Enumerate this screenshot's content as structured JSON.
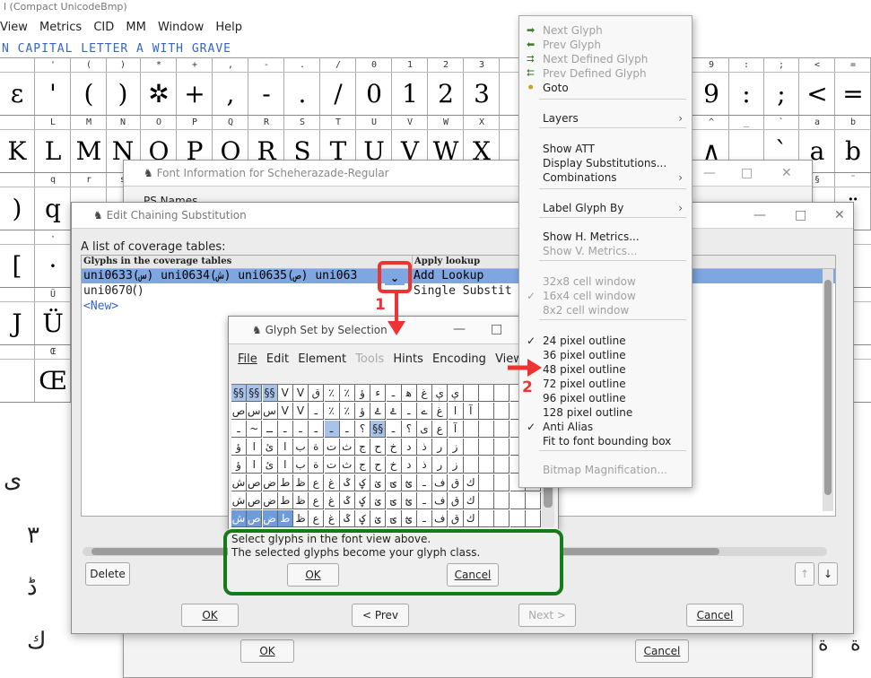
{
  "fontview": {
    "title": "l (Compact UnicodeBmp)",
    "menu": [
      "View",
      "Metrics",
      "CID",
      "MM",
      "Window",
      "Help"
    ],
    "glyph_name": "N CAPITAL LETTER A WITH GRAVE",
    "rows": [
      {
        "hdr": [
          "",
          "'",
          "(",
          ")",
          "*",
          "+",
          ",",
          "-",
          ".",
          "/",
          "0",
          "1",
          "2",
          "3"
        ],
        "big": [
          "ɛ",
          "'",
          "(",
          ")",
          "✲",
          "+",
          ",",
          "-",
          ".",
          "/",
          "0",
          "1",
          "2",
          "3"
        ]
      },
      {
        "hdr": [
          "",
          "L",
          "M",
          "N",
          "O",
          "P",
          "Q",
          "R",
          "S",
          "T",
          "U",
          "V",
          "W",
          "X"
        ],
        "big": [
          "K",
          "L",
          "M",
          "N",
          "O",
          "P",
          "Q",
          "R",
          "S",
          "T",
          "U",
          "V",
          "W",
          "X"
        ]
      },
      {
        "hdr": [
          "",
          "q",
          "r",
          "s"
        ],
        "big": [
          ")",
          "q",
          "",
          ""
        ]
      },
      {
        "hdr": [
          "",
          "·"
        ],
        "big": [
          "[",
          "·"
        ]
      },
      {
        "hdr": [
          "",
          "Ü"
        ],
        "big": [
          "J",
          "Ü"
        ]
      },
      {
        "hdr": [
          "",
          "Œ"
        ],
        "big": [
          "",
          "Œ"
        ]
      }
    ],
    "right_rows": [
      {
        "hdr": [
          "9",
          ":",
          ";",
          "<",
          "="
        ],
        "big": [
          "9",
          ":",
          ";",
          "<",
          "="
        ]
      },
      {
        "hdr": [
          "^",
          "_",
          "`",
          "a",
          "b"
        ],
        "big": [
          "∧",
          "",
          "`",
          "a",
          "b"
        ]
      },
      {
        "hdr": [
          "",
          "",
          "",
          "§",
          "¨"
        ],
        "big": [
          "",
          "",
          "",
          "ς",
          "¨"
        ]
      }
    ],
    "left_col_bottom": [
      "ى",
      "٣",
      "ڈ",
      "ك"
    ],
    "right_col_bottom": [
      "ة",
      "ة"
    ]
  },
  "fontinfo": {
    "title": "Font Information for Scheherazade-Regular",
    "ps_label": "PS Names",
    "ok": "OK",
    "cancel": "Cancel"
  },
  "chain": {
    "title": "Edit Chaining Substitution",
    "coverage_label": "A list of coverage tables:",
    "col1": "Glyphs in the coverage tables",
    "col2": "Apply lookup",
    "rows": [
      {
        "glyphs": "uni0633(س) uni0634(ش) uni0635(ص) uni063",
        "lookup": "Add Lookup"
      },
      {
        "glyphs": "uni0670(ٰ)",
        "lookup": "Single Substit"
      }
    ],
    "new_label": "<New>",
    "delete": "Delete",
    "ok": "OK",
    "prev": "< Prev",
    "next": "Next >",
    "cancel": "Cancel",
    "up": "↑",
    "down": "↓"
  },
  "gsel": {
    "title": "Glyph Set by Selection",
    "menu": [
      "File",
      "Edit",
      "Element",
      "Tools",
      "Hints",
      "Encoding",
      "View"
    ],
    "msg1": "Select glyphs in the font view above.",
    "msg2": "The selected glyphs become your glyph class.",
    "ok": "OK",
    "cancel": "Cancel"
  },
  "menu": {
    "items": [
      {
        "label": "Next Glyph",
        "disabled": true
      },
      {
        "label": "Prev Glyph",
        "disabled": true
      },
      {
        "label": "Next Defined Glyph",
        "disabled": true
      },
      {
        "label": "Prev Defined Glyph",
        "disabled": true
      },
      {
        "label": "Goto",
        "disabled": false
      },
      {
        "label": "Layers",
        "disabled": false
      },
      {
        "label": "Show ATT",
        "disabled": false
      },
      {
        "label": "Display Substitutions...",
        "disabled": false
      },
      {
        "label": "Combinations",
        "disabled": false
      },
      {
        "label": "Label Glyph By",
        "disabled": false
      },
      {
        "label": "Show H. Metrics...",
        "disabled": false
      },
      {
        "label": "Show V. Metrics...",
        "disabled": true
      },
      {
        "label": "32x8 cell window",
        "disabled": true
      },
      {
        "label": "16x4 cell window",
        "disabled": true
      },
      {
        "label": "8x2  cell window",
        "disabled": true
      },
      {
        "label": "24 pixel outline",
        "disabled": false
      },
      {
        "label": "36 pixel outline",
        "disabled": false
      },
      {
        "label": "48 pixel outline",
        "disabled": false
      },
      {
        "label": "72 pixel outline",
        "disabled": false
      },
      {
        "label": "96 pixel outline",
        "disabled": false
      },
      {
        "label": "128 pixel outline",
        "disabled": false
      },
      {
        "label": "Anti Alias",
        "disabled": false
      },
      {
        "label": "Fit to font bounding box",
        "disabled": false
      },
      {
        "label": "Bitmap Magnification...",
        "disabled": true
      }
    ]
  },
  "annotations": {
    "step1": "1",
    "step2": "2"
  },
  "colors": {
    "selection": "#7ea6e0",
    "highlight_green": "#157a1a",
    "annotation_red": "#ee3333"
  }
}
